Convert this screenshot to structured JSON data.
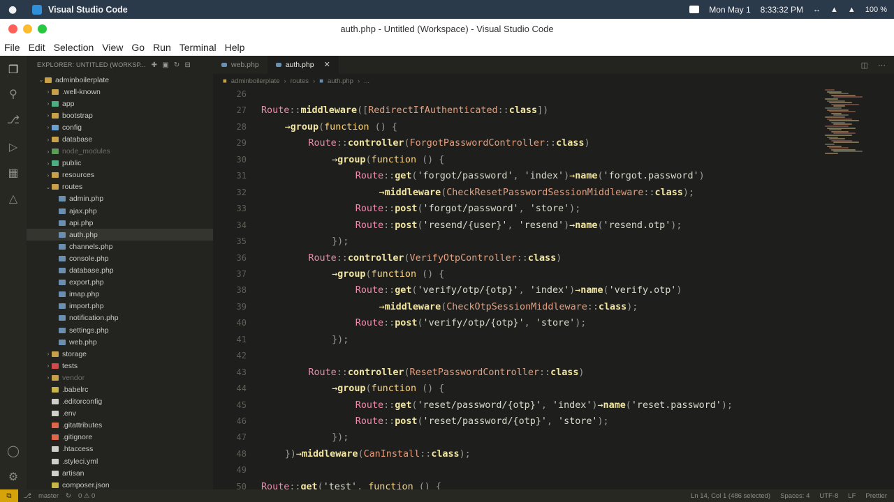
{
  "macbar": {
    "apple": "",
    "app_name": "Visual Studio Code",
    "date": "Mon May 1",
    "time": "8:33:32 PM",
    "battery": "100 %"
  },
  "window": {
    "title": "auth.php - Untitled (Workspace) - Visual Studio Code"
  },
  "menu": [
    "File",
    "Edit",
    "Selection",
    "View",
    "Go",
    "Run",
    "Terminal",
    "Help"
  ],
  "sidebar": {
    "header": "EXPLORER: UNTITLED (WORKSP...",
    "items": [
      {
        "label": "adminboilerplate",
        "depth": 0,
        "type": "folder-open",
        "color": "#c7a14a"
      },
      {
        "label": ".well-known",
        "depth": 1,
        "type": "folder",
        "color": "#c7a14a"
      },
      {
        "label": "app",
        "depth": 1,
        "type": "folder",
        "color": "#4caf82"
      },
      {
        "label": "bootstrap",
        "depth": 1,
        "type": "folder",
        "color": "#c7a14a"
      },
      {
        "label": "config",
        "depth": 1,
        "type": "folder",
        "color": "#6aa0d0"
      },
      {
        "label": "database",
        "depth": 1,
        "type": "folder",
        "color": "#c7a14a"
      },
      {
        "label": "node_modules",
        "depth": 1,
        "type": "folder",
        "color": "#5d9b59",
        "dim": true
      },
      {
        "label": "public",
        "depth": 1,
        "type": "folder",
        "color": "#4caf82"
      },
      {
        "label": "resources",
        "depth": 1,
        "type": "folder",
        "color": "#c7a14a"
      },
      {
        "label": "routes",
        "depth": 1,
        "type": "folder-open",
        "color": "#c7a14a"
      },
      {
        "label": "admin.php",
        "depth": 2,
        "type": "file",
        "color": "#6a8fb0"
      },
      {
        "label": "ajax.php",
        "depth": 2,
        "type": "file",
        "color": "#6a8fb0"
      },
      {
        "label": "api.php",
        "depth": 2,
        "type": "file",
        "color": "#6a8fb0"
      },
      {
        "label": "auth.php",
        "depth": 2,
        "type": "file",
        "color": "#6a8fb0",
        "selected": true
      },
      {
        "label": "channels.php",
        "depth": 2,
        "type": "file",
        "color": "#6a8fb0"
      },
      {
        "label": "console.php",
        "depth": 2,
        "type": "file",
        "color": "#6a8fb0"
      },
      {
        "label": "database.php",
        "depth": 2,
        "type": "file",
        "color": "#6a8fb0"
      },
      {
        "label": "export.php",
        "depth": 2,
        "type": "file",
        "color": "#6a8fb0"
      },
      {
        "label": "imap.php",
        "depth": 2,
        "type": "file",
        "color": "#6a8fb0"
      },
      {
        "label": "import.php",
        "depth": 2,
        "type": "file",
        "color": "#6a8fb0"
      },
      {
        "label": "notification.php",
        "depth": 2,
        "type": "file",
        "color": "#6a8fb0"
      },
      {
        "label": "settings.php",
        "depth": 2,
        "type": "file",
        "color": "#6a8fb0"
      },
      {
        "label": "web.php",
        "depth": 2,
        "type": "file",
        "color": "#6a8fb0"
      },
      {
        "label": "storage",
        "depth": 1,
        "type": "folder",
        "color": "#c7a14a"
      },
      {
        "label": "tests",
        "depth": 1,
        "type": "folder",
        "color": "#d04a4a"
      },
      {
        "label": "vendor",
        "depth": 1,
        "type": "folder",
        "color": "#c7a14a",
        "dim": true
      },
      {
        "label": ".babelrc",
        "depth": 1,
        "type": "file",
        "color": "#c7b54a"
      },
      {
        "label": ".editorconfig",
        "depth": 1,
        "type": "file",
        "color": "#cfcfc9"
      },
      {
        "label": ".env",
        "depth": 1,
        "type": "file",
        "color": "#cfcfc9"
      },
      {
        "label": ".gitattributes",
        "depth": 1,
        "type": "file",
        "color": "#e0664a"
      },
      {
        "label": ".gitignore",
        "depth": 1,
        "type": "file",
        "color": "#e0664a"
      },
      {
        "label": ".htaccess",
        "depth": 1,
        "type": "file",
        "color": "#cfcfc9"
      },
      {
        "label": ".styleci.yml",
        "depth": 1,
        "type": "file",
        "color": "#cfcfc9"
      },
      {
        "label": "artisan",
        "depth": 1,
        "type": "file",
        "color": "#cfcfc9"
      },
      {
        "label": "composer.json",
        "depth": 1,
        "type": "file",
        "color": "#c7b54a"
      }
    ]
  },
  "tabs": [
    {
      "label": "web.php",
      "active": false
    },
    {
      "label": "auth.php",
      "active": true
    }
  ],
  "breadcrumb": [
    "adminboilerplate",
    "routes",
    "auth.php",
    "..."
  ],
  "code": [
    {
      "n": "26",
      "tokens": []
    },
    {
      "n": "27",
      "tokens": [
        [
          "route",
          "Route"
        ],
        [
          "punc",
          "::"
        ],
        [
          "method",
          "middleware"
        ],
        [
          "punc",
          "(["
        ],
        [
          "class",
          "RedirectIfAuthenticated"
        ],
        [
          "punc",
          "::"
        ],
        [
          "cls",
          "class"
        ],
        [
          "punc",
          "])"
        ]
      ]
    },
    {
      "n": "28",
      "indent": 1,
      "tokens": [
        [
          "arrow",
          "→"
        ],
        [
          "method",
          "group"
        ],
        [
          "punc",
          "("
        ],
        [
          "fn",
          "function"
        ],
        [
          "punc",
          " () {"
        ]
      ]
    },
    {
      "n": "29",
      "indent": 2,
      "tokens": [
        [
          "route",
          "Route"
        ],
        [
          "punc",
          "::"
        ],
        [
          "method",
          "controller"
        ],
        [
          "punc",
          "("
        ],
        [
          "class",
          "ForgotPasswordController"
        ],
        [
          "punc",
          "::"
        ],
        [
          "cls",
          "class"
        ],
        [
          "punc",
          ")"
        ]
      ]
    },
    {
      "n": "30",
      "indent": 3,
      "tokens": [
        [
          "arrow",
          "→"
        ],
        [
          "method",
          "group"
        ],
        [
          "punc",
          "("
        ],
        [
          "fn",
          "function"
        ],
        [
          "punc",
          " () {"
        ]
      ]
    },
    {
      "n": "31",
      "indent": 4,
      "tokens": [
        [
          "route",
          "Route"
        ],
        [
          "punc",
          "::"
        ],
        [
          "method",
          "get"
        ],
        [
          "punc",
          "("
        ],
        [
          "str",
          "'forgot/password'"
        ],
        [
          "punc",
          ", "
        ],
        [
          "str",
          "'index'"
        ],
        [
          "punc",
          ")"
        ],
        [
          "arrow",
          "→"
        ],
        [
          "method",
          "name"
        ],
        [
          "punc",
          "("
        ],
        [
          "str",
          "'forgot.password'"
        ],
        [
          "punc",
          ")"
        ]
      ]
    },
    {
      "n": "32",
      "indent": 5,
      "tokens": [
        [
          "arrow",
          "→"
        ],
        [
          "method",
          "middleware"
        ],
        [
          "punc",
          "("
        ],
        [
          "class",
          "CheckResetPasswordSessionMiddleware"
        ],
        [
          "punc",
          "::"
        ],
        [
          "cls",
          "class"
        ],
        [
          "punc",
          ");"
        ]
      ]
    },
    {
      "n": "33",
      "indent": 4,
      "tokens": [
        [
          "route",
          "Route"
        ],
        [
          "punc",
          "::"
        ],
        [
          "method",
          "post"
        ],
        [
          "punc",
          "("
        ],
        [
          "str",
          "'forgot/password'"
        ],
        [
          "punc",
          ", "
        ],
        [
          "str",
          "'store'"
        ],
        [
          "punc",
          ");"
        ]
      ]
    },
    {
      "n": "34",
      "indent": 4,
      "tokens": [
        [
          "route",
          "Route"
        ],
        [
          "punc",
          "::"
        ],
        [
          "method",
          "post"
        ],
        [
          "punc",
          "("
        ],
        [
          "str",
          "'resend/{user}'"
        ],
        [
          "punc",
          ", "
        ],
        [
          "str",
          "'resend'"
        ],
        [
          "punc",
          ")"
        ],
        [
          "arrow",
          "→"
        ],
        [
          "method",
          "name"
        ],
        [
          "punc",
          "("
        ],
        [
          "str",
          "'resend.otp'"
        ],
        [
          "punc",
          ");"
        ]
      ]
    },
    {
      "n": "35",
      "indent": 3,
      "tokens": [
        [
          "punc",
          "});"
        ]
      ]
    },
    {
      "n": "36",
      "indent": 2,
      "tokens": [
        [
          "route",
          "Route"
        ],
        [
          "punc",
          "::"
        ],
        [
          "method",
          "controller"
        ],
        [
          "punc",
          "("
        ],
        [
          "class",
          "VerifyOtpController"
        ],
        [
          "punc",
          "::"
        ],
        [
          "cls",
          "class"
        ],
        [
          "punc",
          ")"
        ]
      ]
    },
    {
      "n": "37",
      "indent": 3,
      "tokens": [
        [
          "arrow",
          "→"
        ],
        [
          "method",
          "group"
        ],
        [
          "punc",
          "("
        ],
        [
          "fn",
          "function"
        ],
        [
          "punc",
          " () {"
        ]
      ]
    },
    {
      "n": "38",
      "indent": 4,
      "tokens": [
        [
          "route",
          "Route"
        ],
        [
          "punc",
          "::"
        ],
        [
          "method",
          "get"
        ],
        [
          "punc",
          "("
        ],
        [
          "str",
          "'verify/otp/{otp}'"
        ],
        [
          "punc",
          ", "
        ],
        [
          "str",
          "'index'"
        ],
        [
          "punc",
          ")"
        ],
        [
          "arrow",
          "→"
        ],
        [
          "method",
          "name"
        ],
        [
          "punc",
          "("
        ],
        [
          "str",
          "'verify.otp'"
        ],
        [
          "punc",
          ")"
        ]
      ]
    },
    {
      "n": "39",
      "indent": 5,
      "tokens": [
        [
          "arrow",
          "→"
        ],
        [
          "method",
          "middleware"
        ],
        [
          "punc",
          "("
        ],
        [
          "class",
          "CheckOtpSessionMiddleware"
        ],
        [
          "punc",
          "::"
        ],
        [
          "cls",
          "class"
        ],
        [
          "punc",
          ");"
        ]
      ]
    },
    {
      "n": "40",
      "indent": 4,
      "tokens": [
        [
          "route",
          "Route"
        ],
        [
          "punc",
          "::"
        ],
        [
          "method",
          "post"
        ],
        [
          "punc",
          "("
        ],
        [
          "str",
          "'verify/otp/{otp}'"
        ],
        [
          "punc",
          ", "
        ],
        [
          "str",
          "'store'"
        ],
        [
          "punc",
          ");"
        ]
      ]
    },
    {
      "n": "41",
      "indent": 3,
      "tokens": [
        [
          "punc",
          "});"
        ]
      ]
    },
    {
      "n": "42",
      "tokens": []
    },
    {
      "n": "43",
      "indent": 2,
      "tokens": [
        [
          "route",
          "Route"
        ],
        [
          "punc",
          "::"
        ],
        [
          "method",
          "controller"
        ],
        [
          "punc",
          "("
        ],
        [
          "class",
          "ResetPasswordController"
        ],
        [
          "punc",
          "::"
        ],
        [
          "cls",
          "class"
        ],
        [
          "punc",
          ")"
        ]
      ]
    },
    {
      "n": "44",
      "indent": 3,
      "tokens": [
        [
          "arrow",
          "→"
        ],
        [
          "method",
          "group"
        ],
        [
          "punc",
          "("
        ],
        [
          "fn",
          "function"
        ],
        [
          "punc",
          " () {"
        ]
      ]
    },
    {
      "n": "45",
      "indent": 4,
      "tokens": [
        [
          "route",
          "Route"
        ],
        [
          "punc",
          "::"
        ],
        [
          "method",
          "get"
        ],
        [
          "punc",
          "("
        ],
        [
          "str",
          "'reset/password/{otp}'"
        ],
        [
          "punc",
          ", "
        ],
        [
          "str",
          "'index'"
        ],
        [
          "punc",
          ")"
        ],
        [
          "arrow",
          "→"
        ],
        [
          "method",
          "name"
        ],
        [
          "punc",
          "("
        ],
        [
          "str",
          "'reset.password'"
        ],
        [
          "punc",
          ");"
        ]
      ]
    },
    {
      "n": "46",
      "indent": 4,
      "tokens": [
        [
          "route",
          "Route"
        ],
        [
          "punc",
          "::"
        ],
        [
          "method",
          "post"
        ],
        [
          "punc",
          "("
        ],
        [
          "str",
          "'reset/password/{otp}'"
        ],
        [
          "punc",
          ", "
        ],
        [
          "str",
          "'store'"
        ],
        [
          "punc",
          ");"
        ]
      ]
    },
    {
      "n": "47",
      "indent": 3,
      "tokens": [
        [
          "punc",
          "});"
        ]
      ]
    },
    {
      "n": "48",
      "indent": 1,
      "tokens": [
        [
          "punc",
          "})"
        ],
        [
          "arrow",
          "→"
        ],
        [
          "method",
          "middleware"
        ],
        [
          "punc",
          "("
        ],
        [
          "class",
          "CanInstall"
        ],
        [
          "punc",
          "::"
        ],
        [
          "cls",
          "class"
        ],
        [
          "punc",
          ");"
        ]
      ]
    },
    {
      "n": "49",
      "tokens": []
    },
    {
      "n": "50",
      "tokens": [
        [
          "route",
          "Route"
        ],
        [
          "punc",
          "::"
        ],
        [
          "method",
          "get"
        ],
        [
          "punc",
          "("
        ],
        [
          "str",
          "'test'"
        ],
        [
          "punc",
          ", "
        ],
        [
          "fn",
          "function"
        ],
        [
          "punc",
          " () {"
        ]
      ]
    }
  ],
  "status": {
    "branch": "master",
    "problems": "0 ⚠ 0",
    "cursor": "Ln 14, Col 1 (486 selected)",
    "spaces": "Spaces: 4",
    "encoding": "UTF-8",
    "eol": "LF",
    "formatter": "Prettier"
  }
}
